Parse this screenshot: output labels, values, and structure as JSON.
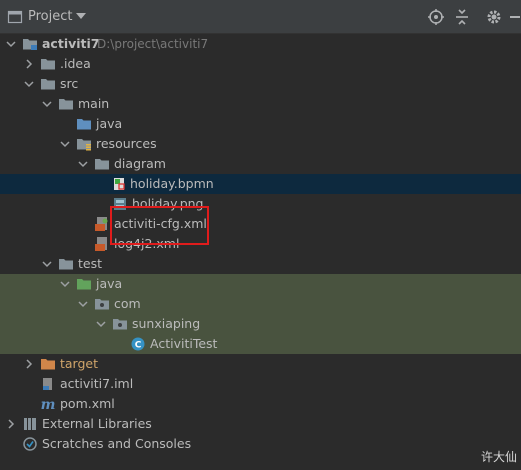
{
  "header": {
    "title": "Project",
    "actions": [
      "locate-icon",
      "collapse-all-icon",
      "gear-icon",
      "hide-icon"
    ]
  },
  "tree": {
    "root_name": "activiti7",
    "root_path": "D:\\project\\activiti7",
    "idea": ".idea",
    "src": "src",
    "main": "main",
    "main_java": "java",
    "resources": "resources",
    "diagram": "diagram",
    "holiday_bpmn": "holiday.bpmn",
    "holiday_png": "holiday.png",
    "activiti_cfg": "activiti-cfg.xml",
    "log4j2": "log4j2.xml",
    "test": "test",
    "test_java": "java",
    "com": "com",
    "sunxiaping": "sunxiaping",
    "activiti_test": "ActivitiTest",
    "target": "target",
    "iml": "activiti7.iml",
    "pom": "pom.xml",
    "external_libraries": "External Libraries",
    "scratches": "Scratches and Consoles"
  },
  "watermark": "许大仙",
  "colors": {
    "background": "#2b2b2b",
    "header": "#3c3f41",
    "selection": "#0d293e",
    "test_highlight": "#49533f",
    "highlight_box": "#e01c1c",
    "folder": "#87939a",
    "excluded_folder": "#d0864a",
    "source_folder": "#5f8fbf"
  }
}
